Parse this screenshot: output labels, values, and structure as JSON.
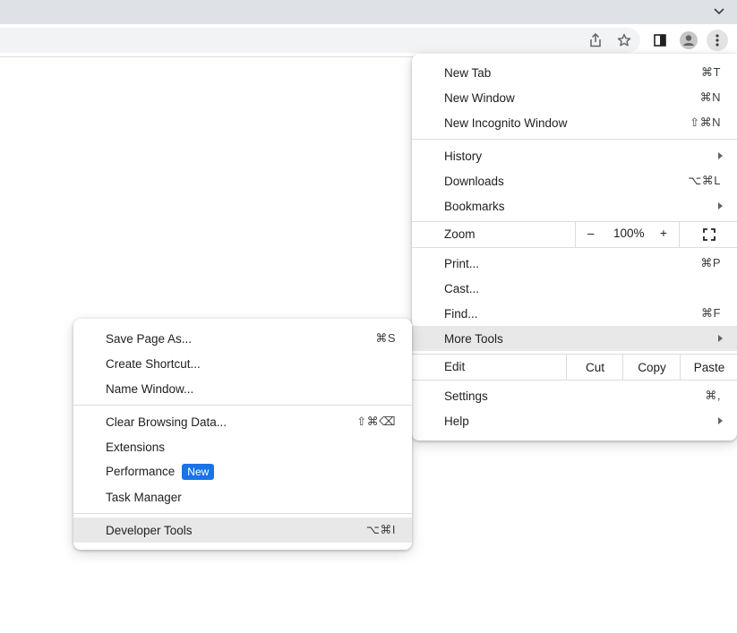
{
  "toolbar": {
    "icons": [
      "share-icon",
      "bookmark-star-icon",
      "side-panel-icon",
      "profile-icon",
      "kebab-menu-icon"
    ]
  },
  "main_menu": {
    "new_tab": {
      "label": "New Tab",
      "shortcut": "⌘T"
    },
    "new_window": {
      "label": "New Window",
      "shortcut": "⌘N"
    },
    "new_incognito": {
      "label": "New Incognito Window",
      "shortcut": "⇧⌘N"
    },
    "history": {
      "label": "History"
    },
    "downloads": {
      "label": "Downloads",
      "shortcut": "⌥⌘L"
    },
    "bookmarks": {
      "label": "Bookmarks"
    },
    "zoom": {
      "label": "Zoom",
      "minus": "–",
      "value": "100%",
      "plus": "+"
    },
    "print": {
      "label": "Print...",
      "shortcut": "⌘P"
    },
    "cast": {
      "label": "Cast..."
    },
    "find": {
      "label": "Find...",
      "shortcut": "⌘F"
    },
    "more_tools": {
      "label": "More Tools"
    },
    "edit": {
      "label": "Edit",
      "cut": "Cut",
      "copy": "Copy",
      "paste": "Paste"
    },
    "settings": {
      "label": "Settings",
      "shortcut": "⌘,"
    },
    "help": {
      "label": "Help"
    }
  },
  "sub_menu": {
    "save_page": {
      "label": "Save Page As...",
      "shortcut": "⌘S"
    },
    "create_shortcut": {
      "label": "Create Shortcut..."
    },
    "name_window": {
      "label": "Name Window..."
    },
    "clear_browsing": {
      "label": "Clear Browsing Data...",
      "shortcut": "⇧⌘⌫"
    },
    "extensions": {
      "label": "Extensions"
    },
    "performance": {
      "label": "Performance",
      "badge": "New"
    },
    "task_manager": {
      "label": "Task Manager"
    },
    "developer_tools": {
      "label": "Developer Tools",
      "shortcut": "⌥⌘I"
    }
  }
}
